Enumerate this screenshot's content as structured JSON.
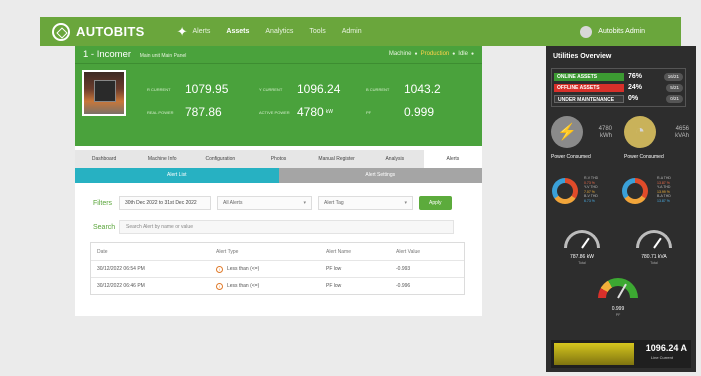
{
  "topbar": {
    "brand": "AUTOBITS",
    "nav": [
      "Alerts",
      "Assets",
      "Analytics",
      "Tools",
      "Admin"
    ],
    "active_nav": "Assets",
    "user": "Autobits Admin"
  },
  "machine": {
    "title": "1 - Incomer",
    "subtitle": "Main unit Main Panel",
    "status": [
      "Machine",
      "Production",
      "Idle"
    ],
    "metrics": [
      {
        "label": "R CURRENT",
        "value": "1079.95",
        "unit": ""
      },
      {
        "label": "Y CURRENT",
        "value": "1096.24",
        "unit": ""
      },
      {
        "label": "B CURRENT",
        "value": "1043.2",
        "unit": ""
      },
      {
        "label": "REAL POWER",
        "value": "787.86",
        "unit": ""
      },
      {
        "label": "ACTIVE POWER",
        "value": "4780",
        "unit": "kW"
      },
      {
        "label": "PF",
        "value": "0.999",
        "unit": ""
      }
    ]
  },
  "tabs": [
    "Dashboard",
    "Machine Info",
    "Configuration",
    "Photos",
    "Manual Register",
    "Analysis",
    "Alerts"
  ],
  "active_tab": "Alerts",
  "subtabs": [
    "Alert List",
    "Alert Settings"
  ],
  "filters": {
    "label": "Filters",
    "date_range": "30th Dec 2022 to 31st Dec 2022",
    "alert_select": "All Alerts",
    "tag_select": "Alert Tag",
    "apply": "Apply"
  },
  "search": {
    "label": "Search",
    "placeholder": "Search Alert by name or value"
  },
  "alert_table": {
    "headers": [
      "Date",
      "Alert Type",
      "Alert Name",
      "Alert Value"
    ],
    "rows": [
      [
        "30/12/2022 06:54 PM",
        "Less than (<=)",
        "PF low",
        "-0.993"
      ],
      [
        "30/12/2022 06:46 PM",
        "Less than (<=)",
        "PF low",
        "-0.996"
      ]
    ]
  },
  "utilities": {
    "title": "Utilities Overview",
    "assets": [
      {
        "label": "ONLINE ASSETS",
        "pct": "76%",
        "frac": "16/21"
      },
      {
        "label": "OFFLINE ASSETS",
        "pct": "24%",
        "frac": "5/21"
      },
      {
        "label": "UNDER MAINTENANCE",
        "pct": "0%",
        "frac": "0/21"
      }
    ],
    "power": {
      "value": "4780",
      "unit": "kWh",
      "caption": "Power Consumed"
    },
    "energy": {
      "value": "4656",
      "unit": "kVAh",
      "caption": "Power Consumed"
    },
    "thd_left": [
      "R-V THD",
      "0.73 %",
      "Y-V THD",
      "7.07 %",
      "B-V THD",
      "6.73 %"
    ],
    "thd_right": [
      "R-A THD",
      "13.87 %",
      "Y-A THD",
      "13.99 %",
      "B-A THD",
      "13.87 %"
    ],
    "gauge_left": {
      "value": "787.86 kW",
      "sub": "Total"
    },
    "gauge_right": {
      "value": "780.71 kVA",
      "sub": "Total"
    },
    "pf": {
      "value": "0.999",
      "sub": "PF"
    },
    "current": {
      "value": "1096.24 A",
      "label": "Line Current"
    }
  }
}
